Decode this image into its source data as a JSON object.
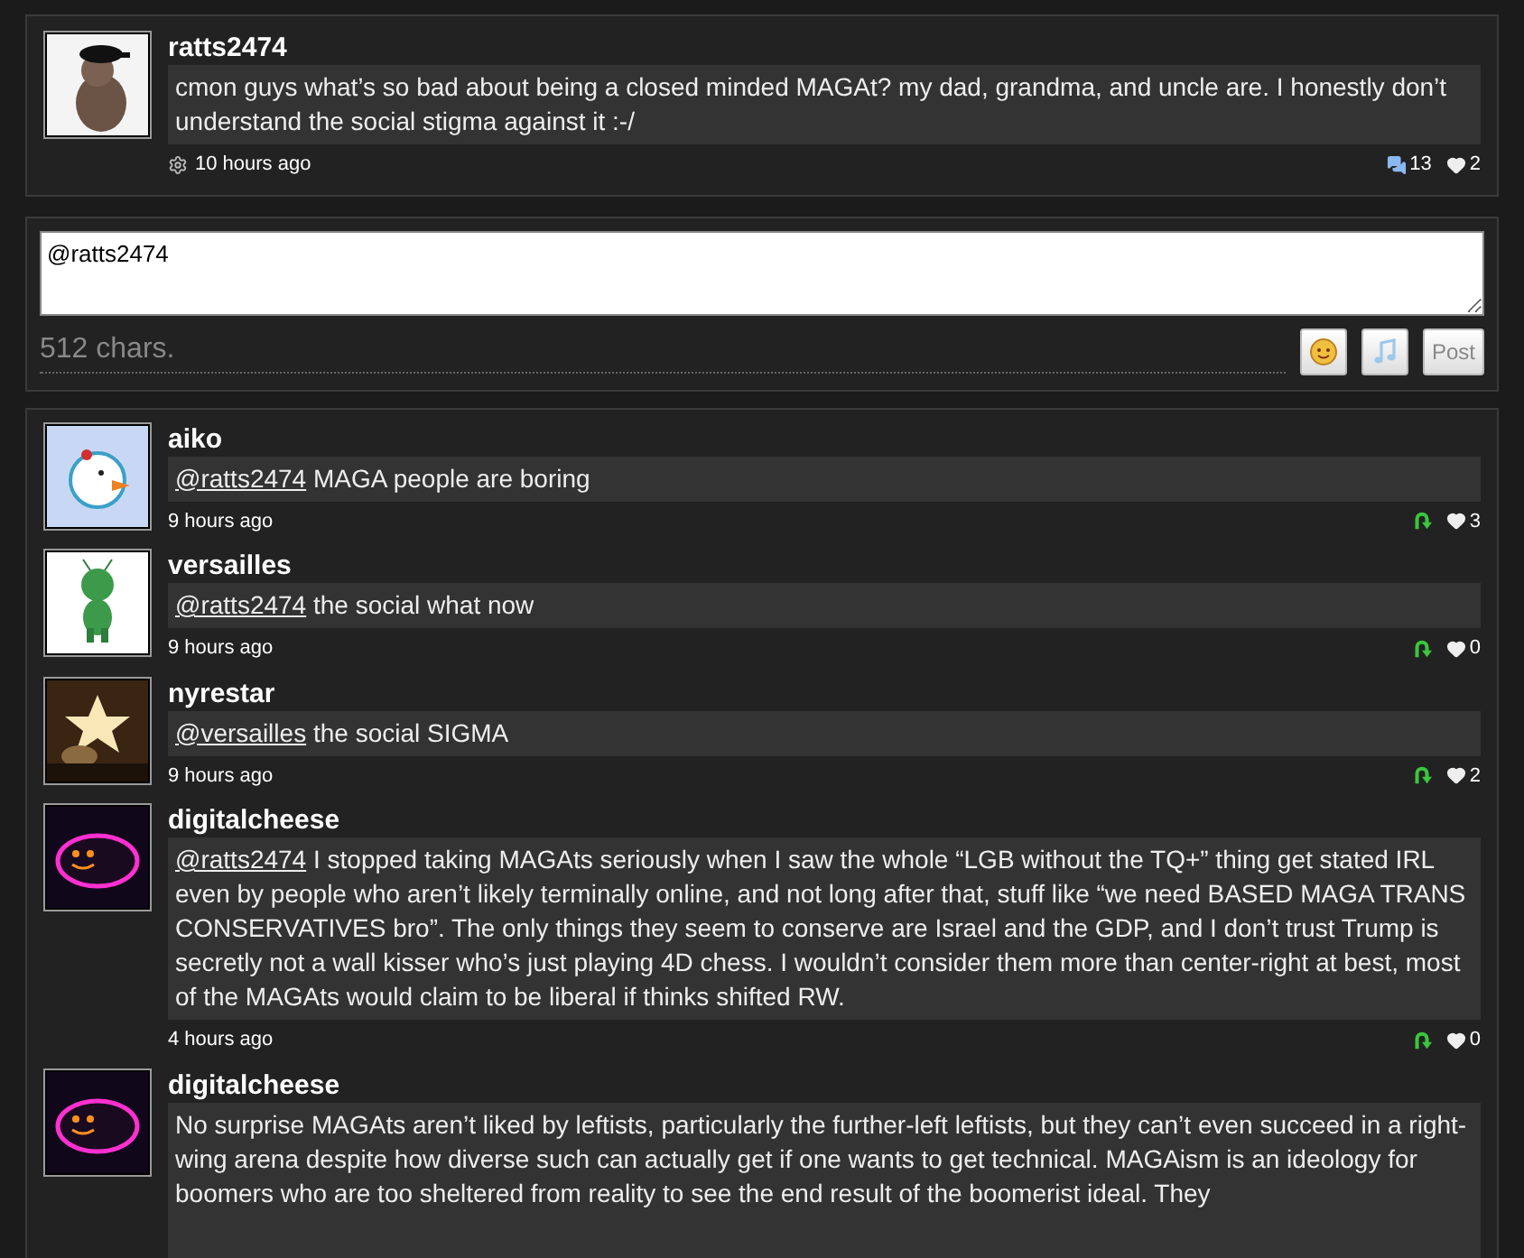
{
  "post": {
    "user": "ratts2474",
    "message": "cmon guys what’s so bad about being a closed minded MAGAt? my dad, grandma, and uncle are. I honestly don’t understand the social stigma against it :-/",
    "time": "10 hours ago",
    "comments": "13",
    "likes": "2"
  },
  "composer": {
    "value": "@ratts2474",
    "counter": "512 chars.",
    "buttons": [
      {
        "kind": "emoji"
      },
      {
        "kind": "music"
      },
      {
        "kind": "text",
        "label": "Post"
      }
    ]
  },
  "replies": [
    {
      "user": "aiko",
      "mention": "@ratts2474",
      "text": "MAGA people are boring",
      "time": "9 hours ago",
      "likes": "3"
    },
    {
      "user": "versailles",
      "mention": "@ratts2474",
      "text": "the social what now",
      "time": "9 hours ago",
      "likes": "0"
    },
    {
      "user": "nyrestar",
      "mention": "@versailles",
      "text": "the social SIGMA",
      "time": "9 hours ago",
      "likes": "2"
    },
    {
      "user": "digitalcheese",
      "mention": "@ratts2474",
      "text": "I stopped taking MAGAts seriously when I saw the whole “LGB without the TQ+” thing get stated IRL even by people who aren’t likely terminally online, and not long after that, stuff like “we need BASED MAGA TRANS CONSERVATIVES bro”. The only things they seem to conserve are Israel and the GDP, and I don’t trust Trump is secretly not a wall kisser who’s just playing 4D chess. I wouldn’t consider them more than center-right at best, most of the MAGAts would claim to be liberal if thinks shifted RW.",
      "time": "4 hours ago",
      "likes": "0"
    },
    {
      "user": "digitalcheese",
      "text": "No surprise MAGAts aren’t liked by leftists, particularly the further-left leftists, but they can’t even succeed in a right-wing arena despite how diverse such can actually get if one wants to get technical. MAGAism is an ideology for boomers who are too sheltered from reality to see the end result of the boomerist ideal. They"
    }
  ]
}
